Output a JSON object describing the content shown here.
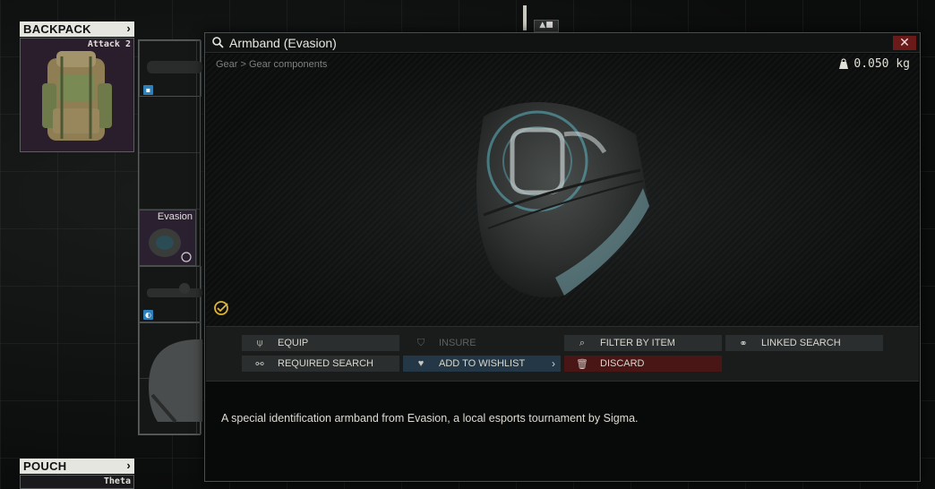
{
  "inventory": {
    "backpack_header": "BACKPACK",
    "backpack_item": "Attack 2",
    "pouch_header": "POUCH",
    "pouch_item": "Theta",
    "evasion_item": "Evasion"
  },
  "modal": {
    "title": "Armband (Evasion)",
    "close_label": "✕",
    "breadcrumb": "Gear > Gear components",
    "weight": "0.050 kg",
    "actions": [
      {
        "label": "EQUIP",
        "icon": "equip-icon"
      },
      {
        "label": "INSURE",
        "icon": "shield-icon",
        "disabled": true
      },
      {
        "label": "FILTER BY ITEM",
        "icon": "magnifier-icon"
      },
      {
        "label": "LINKED SEARCH",
        "icon": "linked-icon"
      },
      {
        "label": "REQUIRED SEARCH",
        "icon": "required-icon"
      },
      {
        "label": "ADD TO WISHLIST",
        "icon": "heart-icon"
      },
      {
        "label": "DISCARD",
        "icon": "trash-icon"
      }
    ],
    "description": "A special identification armband from Evasion, a local esports tournament by Sigma."
  },
  "colors": {
    "accent_examined": "#e0b530",
    "wishlist_bg": "#233746",
    "discard_bg": "#4a1515",
    "close_bg": "#6b1a1a"
  }
}
